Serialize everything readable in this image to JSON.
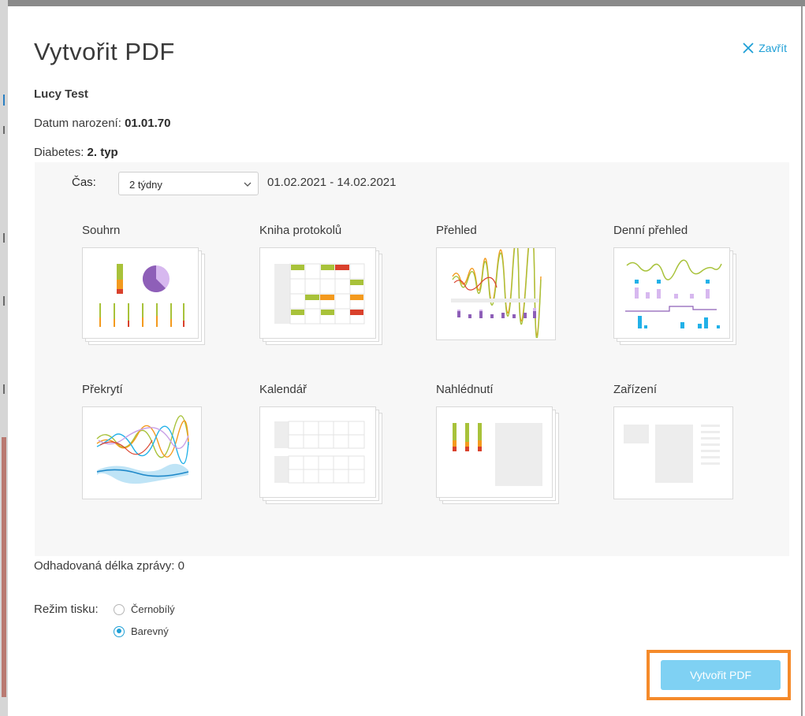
{
  "modal": {
    "title": "Vytvořit PDF",
    "close_label": "Zavřít"
  },
  "patient": {
    "name": "Lucy Test",
    "dob_label": "Datum narození:",
    "dob_value": "01.01.70",
    "diabetes_label": "Diabetes:",
    "diabetes_value": "2. typ"
  },
  "time": {
    "label": "Čas:",
    "selected": "2 týdny",
    "range": "01.02.2021 - 14.02.2021"
  },
  "report_types": [
    {
      "label": "Souhrn",
      "icon": "summary-thumbnail"
    },
    {
      "label": "Kniha protokolů",
      "icon": "logbook-thumbnail"
    },
    {
      "label": "Přehled",
      "icon": "overview-thumbnail"
    },
    {
      "label": "Denní přehled",
      "icon": "daily-overview-thumbnail"
    },
    {
      "label": "Překrytí",
      "icon": "overlay-thumbnail"
    },
    {
      "label": "Kalendář",
      "icon": "calendar-thumbnail"
    },
    {
      "label": "Nahlédnutí",
      "icon": "insight-thumbnail"
    },
    {
      "label": "Zařízení",
      "icon": "device-thumbnail"
    }
  ],
  "estimate": {
    "label": "Odhadovaná délka zprávy:",
    "value": "0"
  },
  "print_mode": {
    "label": "Režim tisku:",
    "options": [
      {
        "label": "Černobílý",
        "selected": false
      },
      {
        "label": "Barevný",
        "selected": true
      }
    ]
  },
  "submit_label": "Vytvořit PDF",
  "colors": {
    "accent": "#1e9fd6",
    "button": "#7fd1f3",
    "highlight": "#f58a2a",
    "green": "#a8c23a",
    "orange": "#f39a1e",
    "red": "#d9412c",
    "purple": "#9b6bc2"
  }
}
